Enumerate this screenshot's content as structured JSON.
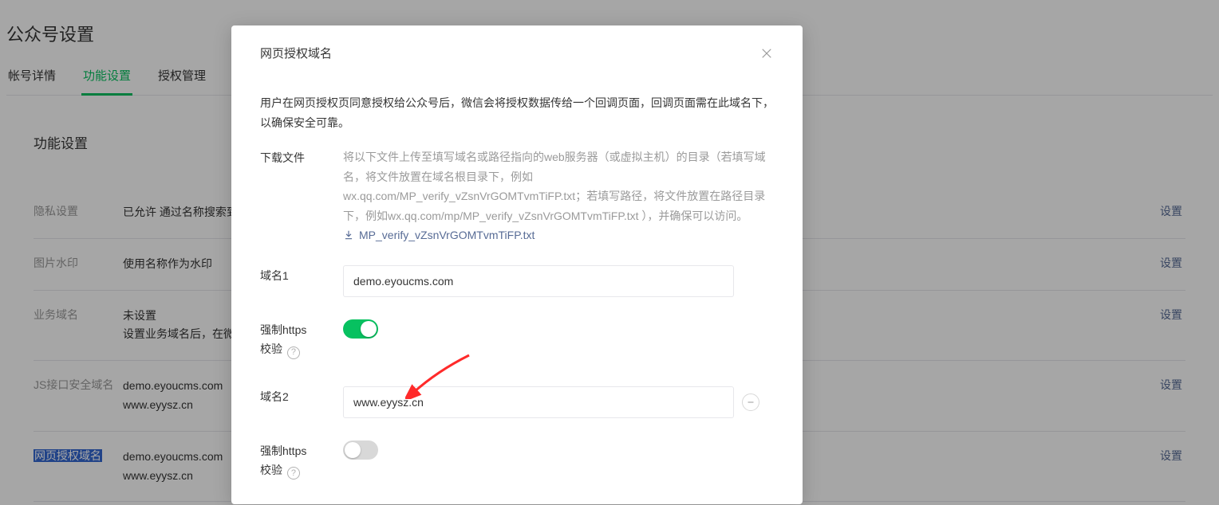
{
  "page": {
    "title": "公众号设置",
    "tabs": [
      "帐号详情",
      "功能设置",
      "授权管理"
    ],
    "active_tab_index": 1,
    "section_title": "功能设置",
    "action_label": "设置",
    "rows": [
      {
        "label": "隐私设置",
        "value": "已允许 通过名称搜索到"
      },
      {
        "label": "图片水印",
        "value": "使用名称作为水印"
      },
      {
        "label": "业务域名",
        "value": "未设置\n设置业务域名后，在微"
      },
      {
        "label": "JS接口安全域名",
        "value": "demo.eyoucms.com\nwww.eyysz.cn"
      },
      {
        "label": "网页授权域名",
        "value": "demo.eyoucms.com\nwww.eyysz.cn",
        "highlighted": true
      }
    ]
  },
  "modal": {
    "title": "网页授权域名",
    "description": "用户在网页授权页同意授权给公众号后，微信会将授权数据传给一个回调页面，回调页面需在此域名下，以确保安全可靠。",
    "download_label": "下载文件",
    "download_help": "将以下文件上传至填写域名或路径指向的web服务器（或虚拟主机）的目录（若填写域名，将文件放置在域名根目录下，例如wx.qq.com/MP_verify_vZsnVrGOMTvmTiFP.txt；若填写路径，将文件放置在路径目录下，例如wx.qq.com/mp/MP_verify_vZsnVrGOMTvmTiFP.txt ），并确保可以访问。",
    "download_filename": "MP_verify_vZsnVrGOMTvmTiFP.txt",
    "domain1_label": "域名1",
    "domain1_value": "demo.eyoucms.com",
    "https_label_line1": "强制https",
    "https_label_line2": "校验",
    "domain2_label": "域名2",
    "domain2_value": "www.eyysz.cn",
    "switch1_on": true,
    "switch2_on": false
  }
}
